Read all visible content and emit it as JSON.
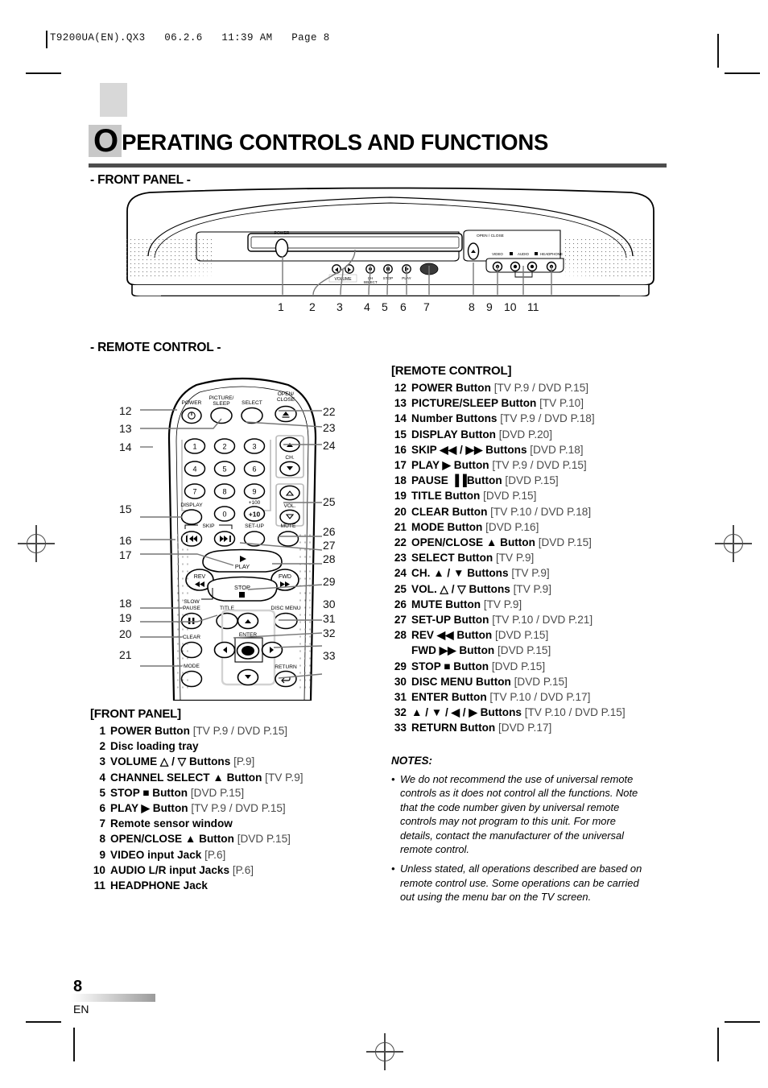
{
  "print_header": "T9200UA(EN).QX3   06.2.6   11:39 AM   Page 8",
  "title": {
    "dropcap": "O",
    "rest": "PERATING CONTROLS AND FUNCTIONS"
  },
  "sections": {
    "front_panel_heading": "- FRONT PANEL -",
    "remote_control_heading": "- REMOTE CONTROL -"
  },
  "front_panel_list": {
    "heading": "[FRONT PANEL]",
    "items": [
      {
        "num": "1",
        "label": "POWER Button",
        "ref": "[TV P.9 / DVD P.15]"
      },
      {
        "num": "2",
        "label": "Disc loading tray",
        "ref": ""
      },
      {
        "num": "3",
        "label": "VOLUME △ / ▽ Buttons",
        "ref": "[P.9]"
      },
      {
        "num": "4",
        "label": "CHANNEL SELECT ▲ Button",
        "ref": "[TV P.9]"
      },
      {
        "num": "5",
        "label": "STOP ■ Button",
        "ref": "[DVD P.15]"
      },
      {
        "num": "6",
        "label": "PLAY ▶ Button",
        "ref": "[TV P.9 / DVD P.15]"
      },
      {
        "num": "7",
        "label": "Remote sensor window",
        "ref": ""
      },
      {
        "num": "8",
        "label": "OPEN/CLOSE ▲ Button",
        "ref": "[DVD P.15]"
      },
      {
        "num": "9",
        "label": "VIDEO input Jack",
        "ref": "[P.6]"
      },
      {
        "num": "10",
        "label": "AUDIO L/R input Jacks",
        "ref": "[P.6]"
      },
      {
        "num": "11",
        "label": "HEADPHONE Jack",
        "ref": ""
      }
    ]
  },
  "remote_list": {
    "heading": "[REMOTE CONTROL]",
    "items": [
      {
        "num": "12",
        "label": "POWER Button",
        "ref": "[TV P.9 / DVD P.15]"
      },
      {
        "num": "13",
        "label": "PICTURE/SLEEP Button",
        "ref": "[TV P.10]"
      },
      {
        "num": "14",
        "label": "Number Buttons",
        "ref": "[TV P.9 / DVD P.18]"
      },
      {
        "num": "15",
        "label": "DISPLAY Button",
        "ref": "[DVD P.20]"
      },
      {
        "num": "16",
        "label": "SKIP ◀◀ / ▶▶ Buttons",
        "ref": "[DVD P.18]"
      },
      {
        "num": "17",
        "label": "PLAY ▶ Button",
        "ref": "[TV P.9 / DVD P.15]"
      },
      {
        "num": "18",
        "label": "PAUSE ▐▐Button",
        "ref": "[DVD P.15]"
      },
      {
        "num": "19",
        "label": "TITLE Button",
        "ref": "[DVD P.15]"
      },
      {
        "num": "20",
        "label": "CLEAR Button",
        "ref": "[TV P.10 / DVD P.18]"
      },
      {
        "num": "21",
        "label": "MODE Button",
        "ref": "[DVD P.16]"
      },
      {
        "num": "22",
        "label": "OPEN/CLOSE ▲ Button",
        "ref": "[DVD P.15]"
      },
      {
        "num": "23",
        "label": "SELECT Button",
        "ref": "[TV P.9]"
      },
      {
        "num": "24",
        "label": "CH. ▲ / ▼ Buttons",
        "ref": "[TV P.9]"
      },
      {
        "num": "25",
        "label": "VOL. △ / ▽ Buttons",
        "ref": "[TV P.9]"
      },
      {
        "num": "26",
        "label": "MUTE Button",
        "ref": "[TV P.9]"
      },
      {
        "num": "27",
        "label": "SET-UP Button",
        "ref": "[TV P.10 / DVD P.21]"
      },
      {
        "num": "28",
        "label": "REV ◀◀ Button",
        "ref": "[DVD P.15]"
      },
      {
        "num": "",
        "label": "FWD ▶▶ Button",
        "ref": "[DVD P.15]",
        "continuation": true
      },
      {
        "num": "29",
        "label": "STOP ■ Button",
        "ref": "[DVD P.15]"
      },
      {
        "num": "30",
        "label": "DISC MENU Button",
        "ref": "[DVD P.15]"
      },
      {
        "num": "31",
        "label": "ENTER Button",
        "ref": "[TV P.10 / DVD P.17]"
      },
      {
        "num": "32",
        "label": "▲ / ▼ / ◀ / ▶ Buttons",
        "ref": "[TV P.10 / DVD P.15]"
      },
      {
        "num": "33",
        "label": "RETURN Button",
        "ref": "[DVD P.17]"
      }
    ]
  },
  "notes": {
    "title": "NOTES:",
    "items": [
      "We do not recommend the use of universal remote controls as it does not control all the functions. Note that the code number given by universal remote controls may not program to this unit. For more details, contact the manufacturer of the universal remote control.",
      "Unless stated, all operations described are based on remote control use. Some operations can be carried out using the menu bar on the TV screen."
    ]
  },
  "footer": {
    "page_number": "8",
    "language": "EN"
  },
  "front_panel_diagram": {
    "labels": {
      "power": "POWER",
      "volume": "VOLUME",
      "ch_select": "CH\nSELECT",
      "stop": "STOP",
      "play": "PLAY",
      "open_close": "OPEN / CLOSE",
      "video": "VIDEO",
      "audio": "AUDIO",
      "headphone": "HEADPHONE"
    },
    "callouts": [
      "1",
      "2",
      "3",
      "4",
      "5",
      "6",
      "7",
      "8",
      "9",
      "10",
      "11"
    ]
  },
  "remote_diagram": {
    "labels": {
      "power": "POWER",
      "picture_sleep": "PICTURE/\nSLEEP",
      "select": "SELECT",
      "open_close": "OPEN/\nCLOSE",
      "display": "DISPLAY",
      "skip": "SKIP",
      "setup": "SET-UP",
      "mute": "MUTE",
      "ch": "CH.",
      "vol": "VOL.",
      "plus100": "+100",
      "plus10": "+10",
      "play": "PLAY",
      "rev": "REV",
      "fwd": "FWD",
      "stop": "STOP",
      "slow": "SLOW",
      "pause": "PAUSE",
      "title": "TITLE",
      "disc_menu": "DISC MENU",
      "clear": "CLEAR",
      "mode": "MODE",
      "enter": "ENTER",
      "return": "RETURN"
    },
    "number_keys": [
      "1",
      "2",
      "3",
      "4",
      "5",
      "6",
      "7",
      "8",
      "9",
      "0"
    ],
    "callouts_left": [
      "12",
      "13",
      "14",
      "15",
      "16",
      "17",
      "18",
      "19",
      "20",
      "21"
    ],
    "callouts_right": [
      "22",
      "23",
      "24",
      "25",
      "26",
      "27",
      "28",
      "29",
      "30",
      "31",
      "32",
      "33"
    ]
  }
}
